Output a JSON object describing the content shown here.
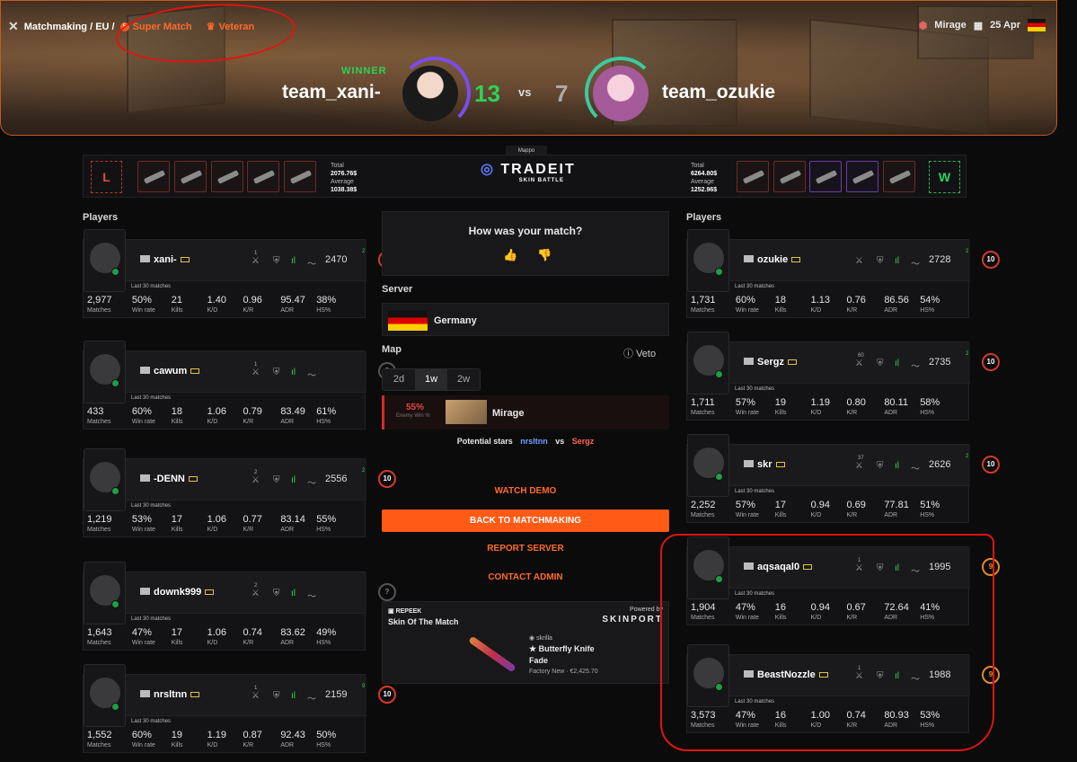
{
  "header": {
    "crumb": "Matchmaking / EU /",
    "super_match": "Super Match",
    "veteran": "Veteran",
    "map": "Mirage",
    "date": "25 Apr"
  },
  "match": {
    "winner_label": "WINNER",
    "team1": "team_xani-",
    "team2": "team_ozukie",
    "score1": "13",
    "score2": "7",
    "vs": "vs"
  },
  "strip": {
    "left_letter": "L",
    "right_letter": "W",
    "left_total_label": "Total",
    "left_total": "2076.76$",
    "left_avg_label": "Average",
    "left_avg": "1038.38$",
    "right_total_label": "Total",
    "right_total": "6264.80$",
    "right_avg_label": "Average",
    "right_avg": "1252.96$",
    "brand": "TRADEIT",
    "sub": "SKIN BATTLE",
    "mappo": "Mappo"
  },
  "labels": {
    "players": "Players",
    "last30": "Last 30 matches",
    "matches": "Matches",
    "winrate": "Win rate",
    "kills": "Kills",
    "kd": "K/D",
    "kr": "K/R",
    "adr": "ADR",
    "hs": "HS%"
  },
  "left_players": [
    {
      "name": "xani-",
      "elo": "2470",
      "lvl": "10",
      "n": "1",
      "up": "2",
      "matches": "2,977",
      "wr": "50%",
      "kills": "21",
      "kd": "1.40",
      "kr": "0.96",
      "adr": "95.47",
      "hs": "38%"
    },
    {
      "name": "cawum",
      "elo": "",
      "lvl": "?",
      "n": "1",
      "up": "",
      "matches": "433",
      "wr": "60%",
      "kills": "18",
      "kd": "1.06",
      "kr": "0.79",
      "adr": "83.49",
      "hs": "61%"
    },
    {
      "name": "-DENN",
      "elo": "2556",
      "lvl": "10",
      "n": "2",
      "up": "2",
      "matches": "1,219",
      "wr": "53%",
      "kills": "17",
      "kd": "1.06",
      "kr": "0.77",
      "adr": "83.14",
      "hs": "55%"
    },
    {
      "name": "downk999",
      "elo": "",
      "lvl": "?",
      "n": "2",
      "up": "",
      "matches": "1,643",
      "wr": "47%",
      "kills": "17",
      "kd": "1.06",
      "kr": "0.74",
      "adr": "83.62",
      "hs": "49%"
    },
    {
      "name": "nrsltnn",
      "elo": "2159",
      "lvl": "10",
      "n": "1",
      "up": "9",
      "matches": "1,552",
      "wr": "60%",
      "kills": "19",
      "kd": "1.19",
      "kr": "0.87",
      "adr": "92.43",
      "hs": "50%"
    }
  ],
  "right_players": [
    {
      "name": "ozukie",
      "elo": "2728",
      "lvl": "10",
      "n": "",
      "up": "2",
      "matches": "1,731",
      "wr": "60%",
      "kills": "18",
      "kd": "1.13",
      "kr": "0.76",
      "adr": "86.56",
      "hs": "54%"
    },
    {
      "name": "Sergz",
      "elo": "2735",
      "lvl": "10",
      "n": "60",
      "up": "2",
      "matches": "1,711",
      "wr": "57%",
      "kills": "19",
      "kd": "1.19",
      "kr": "0.80",
      "adr": "80.11",
      "hs": "58%"
    },
    {
      "name": "skr",
      "elo": "2626",
      "lvl": "10",
      "n": "37",
      "up": "2",
      "matches": "2,252",
      "wr": "57%",
      "kills": "17",
      "kd": "0.94",
      "kr": "0.69",
      "adr": "77.81",
      "hs": "51%"
    },
    {
      "name": "aqsaqal0",
      "elo": "1995",
      "lvl": "9",
      "n": "1",
      "up": "",
      "matches": "1,904",
      "wr": "47%",
      "kills": "16",
      "kd": "0.94",
      "kr": "0.67",
      "adr": "72.64",
      "hs": "41%"
    },
    {
      "name": "BeastNozzle",
      "elo": "1988",
      "lvl": "9",
      "n": "1",
      "up": "",
      "matches": "3,573",
      "wr": "47%",
      "kills": "16",
      "kd": "1.00",
      "kr": "0.74",
      "adr": "80.93",
      "hs": "53%"
    }
  ],
  "center": {
    "feedback": "How was your match?",
    "server_label": "Server",
    "server": "Germany",
    "map_label": "Map",
    "veto": "Veto",
    "tabs": [
      "2d",
      "1w",
      "2w"
    ],
    "map_pct": "55%",
    "map_pct_sub": "Enemy Win %",
    "map_name": "Mirage",
    "stars_label": "Potential stars",
    "star1": "nrsltnn",
    "star_vs": "vs",
    "star2": "Sergz",
    "watch": "WATCH DEMO",
    "back": "BACK TO MATCHMAKING",
    "report": "REPORT SERVER",
    "contact": "CONTACT ADMIN"
  },
  "skin": {
    "brand": "REPEEK",
    "title": "Skin Of The Match",
    "powered": "Powered by",
    "sponsor": "SKINPORT",
    "owner": "skrilla",
    "item": "★ Butterfly Knife",
    "finish": "Fade",
    "price": "Factory New · €2,425.70"
  }
}
